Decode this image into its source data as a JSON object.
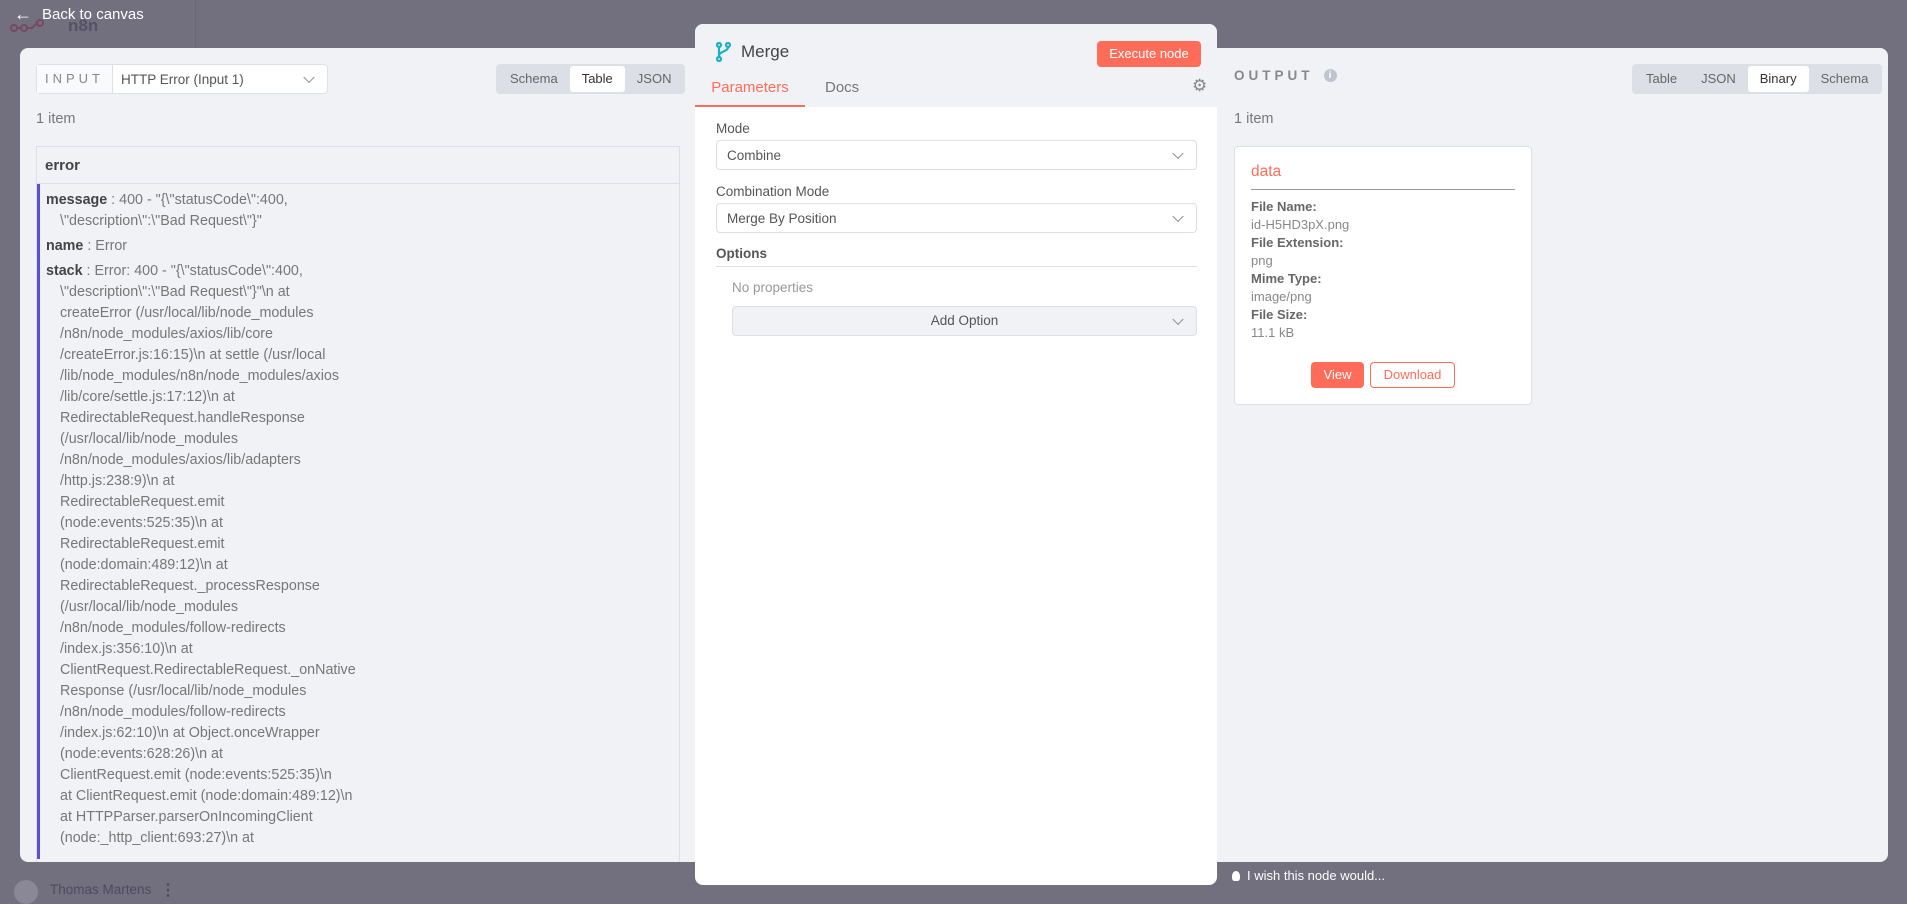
{
  "nav": {
    "back_label": "Back to canvas",
    "logo": "n8n",
    "user": "Thomas Martens",
    "feedback": "I wish this node would..."
  },
  "input": {
    "label": "INPUT",
    "selected_input": "HTTP Error (Input 1)",
    "tabs": [
      "Schema",
      "Table",
      "JSON"
    ],
    "active_tab": "Table",
    "item_count": "1 item",
    "column": "error",
    "fields": {
      "message_key": "message",
      "message_lines": [
        "400 - \"{\\\"statusCode\\\":400,",
        "\\\"description\\\":\\\"Bad Request\\\"}\""
      ],
      "name_key": "name",
      "name_value": "Error",
      "stack_key": "stack",
      "stack_lines": [
        "Error: 400 - \"{\\\"statusCode\\\":400,",
        "\\\"description\\\":\\\"Bad Request\\\"}\"\\n    at",
        "createError (/usr/local/lib/node_modules",
        "/n8n/node_modules/axios/lib/core",
        "/createError.js:16:15)\\n    at settle (/usr/local",
        "/lib/node_modules/n8n/node_modules/axios",
        "/lib/core/settle.js:17:12)\\n    at",
        "RedirectableRequest.handleResponse",
        "(/usr/local/lib/node_modules",
        "/n8n/node_modules/axios/lib/adapters",
        "/http.js:238:9)\\n    at",
        "RedirectableRequest.emit",
        "(node:events:525:35)\\n    at",
        "RedirectableRequest.emit",
        "(node:domain:489:12)\\n    at",
        "RedirectableRequest._processResponse",
        "(/usr/local/lib/node_modules",
        "/n8n/node_modules/follow-redirects",
        "/index.js:356:10)\\n    at",
        "ClientRequest.RedirectableRequest._onNative",
        "Response (/usr/local/lib/node_modules",
        "/n8n/node_modules/follow-redirects",
        "/index.js:62:10)\\n    at Object.onceWrapper",
        "(node:events:628:26)\\n    at",
        "ClientRequest.emit (node:events:525:35)\\n",
        "at ClientRequest.emit (node:domain:489:12)\\n",
        "at HTTPParser.parserOnIncomingClient",
        "(node:_http_client:693:27)\\n    at"
      ]
    }
  },
  "node": {
    "title": "Merge",
    "execute_label": "Execute node",
    "tabs": [
      "Parameters",
      "Docs"
    ],
    "active_tab": "Parameters",
    "mode_label": "Mode",
    "mode_value": "Combine",
    "combination_label": "Combination Mode",
    "combination_value": "Merge By Position",
    "options_label": "Options",
    "no_properties": "No properties",
    "add_option": "Add Option"
  },
  "output": {
    "label": "OUTPUT",
    "tabs": [
      "Table",
      "JSON",
      "Binary",
      "Schema"
    ],
    "active_tab": "Binary",
    "item_count": "1 item",
    "binary": {
      "key": "data",
      "file_name_label": "File Name:",
      "file_name": "id-H5HD3pX.png",
      "ext_label": "File Extension:",
      "ext": "png",
      "mime_label": "Mime Type:",
      "mime": "image/png",
      "size_label": "File Size:",
      "size": "11.1 kB",
      "view": "View",
      "download": "Download"
    }
  },
  "colors": {
    "accent": "#ff6d5a",
    "overlay": "#72707f",
    "panel": "#f1f2f6",
    "merge_icon": "#1eb0c4",
    "border_left": "#5b4fd6"
  }
}
